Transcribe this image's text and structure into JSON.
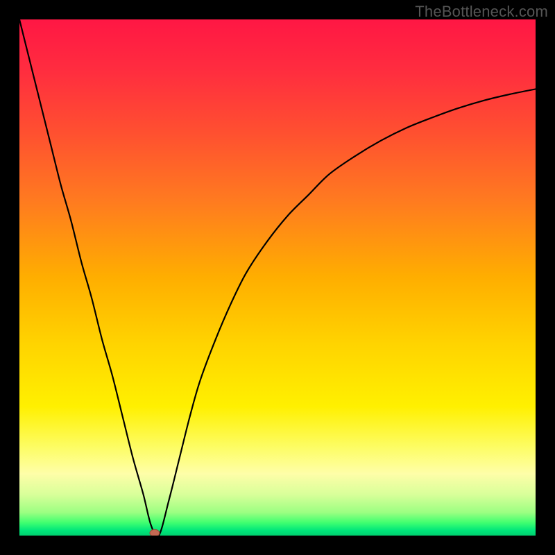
{
  "watermark": "TheBottleneck.com",
  "palette": {
    "background": "#000000",
    "curve": "#000000",
    "marker_fill": "#c46a54",
    "marker_stroke": "#9a4a38"
  },
  "gradient_stops": [
    {
      "offset": 0.0,
      "color": "#ff1744"
    },
    {
      "offset": 0.1,
      "color": "#ff2d3f"
    },
    {
      "offset": 0.22,
      "color": "#ff5030"
    },
    {
      "offset": 0.35,
      "color": "#ff7a20"
    },
    {
      "offset": 0.5,
      "color": "#ffae00"
    },
    {
      "offset": 0.63,
      "color": "#ffd400"
    },
    {
      "offset": 0.75,
      "color": "#fff000"
    },
    {
      "offset": 0.83,
      "color": "#fdfd66"
    },
    {
      "offset": 0.88,
      "color": "#fefea8"
    },
    {
      "offset": 0.92,
      "color": "#d9ff9a"
    },
    {
      "offset": 0.955,
      "color": "#9cff82"
    },
    {
      "offset": 0.975,
      "color": "#40ff70"
    },
    {
      "offset": 0.99,
      "color": "#00e67a"
    },
    {
      "offset": 1.0,
      "color": "#00d070"
    }
  ],
  "chart_data": {
    "type": "line",
    "title": "",
    "xlabel": "",
    "ylabel": "",
    "xlim": [
      0,
      100
    ],
    "ylim": [
      0,
      100
    ],
    "grid": false,
    "legend": false,
    "x": [
      0,
      2,
      4,
      6,
      8,
      10,
      12,
      14,
      16,
      18,
      20,
      22,
      24,
      25.5,
      27,
      29,
      31,
      33,
      35,
      38,
      41,
      44,
      48,
      52,
      56,
      60,
      65,
      70,
      75,
      80,
      85,
      90,
      95,
      100
    ],
    "y": [
      100,
      92,
      84,
      76,
      68,
      61,
      53,
      46,
      38,
      31,
      23,
      15,
      8,
      2,
      0,
      7,
      15,
      23,
      30,
      38,
      45,
      51,
      57,
      62,
      66,
      70,
      73.5,
      76.5,
      79,
      81,
      82.8,
      84.3,
      85.5,
      86.5
    ],
    "marker": {
      "x": 26.2,
      "y": 0.5
    }
  }
}
